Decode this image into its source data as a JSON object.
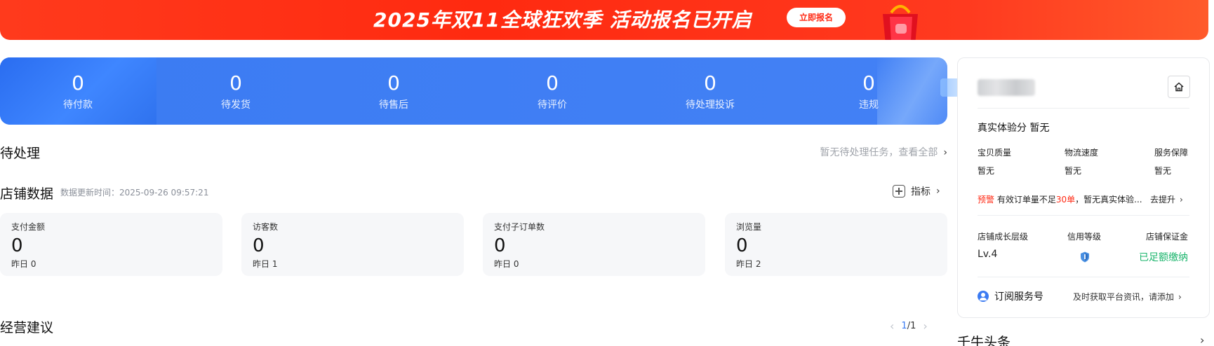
{
  "banner": {
    "title": "2025年双11全球狂欢季 活动报名已开启",
    "button_label": "立即报名"
  },
  "order_status": [
    {
      "value": "0",
      "label": "待付款"
    },
    {
      "value": "0",
      "label": "待发货"
    },
    {
      "value": "0",
      "label": "待售后"
    },
    {
      "value": "0",
      "label": "待评价"
    },
    {
      "value": "0",
      "label": "待处理投诉"
    },
    {
      "value": "0",
      "label": "违规"
    }
  ],
  "pending": {
    "title": "待处理",
    "link_text": "暂无待处理任务，查看全部"
  },
  "store_data": {
    "title": "店铺数据",
    "update_time": "数据更新时间：2025-09-26 09:57:21",
    "metrics_link": "指标",
    "cards": [
      {
        "label": "支付金额",
        "value": "0",
        "yesterday": "昨日 0"
      },
      {
        "label": "访客数",
        "value": "0",
        "yesterday": "昨日 1"
      },
      {
        "label": "支付子订单数",
        "value": "0",
        "yesterday": "昨日 0"
      },
      {
        "label": "浏览量",
        "value": "0",
        "yesterday": "昨日 2"
      }
    ]
  },
  "advice": {
    "title": "经营建议",
    "page_current": "1",
    "page_sep": "/",
    "page_total": "1"
  },
  "panel": {
    "experience_title": "真实体验分 暂无",
    "quality_label": "宝贝质量",
    "quality_value": "暂无",
    "logistics_label": "物流速度",
    "logistics_value": "暂无",
    "service_label": "服务保障",
    "service_value": "暂无",
    "warn_prefix": "预警",
    "warn_mid": " 有效订单量不足",
    "warn_red": "30单",
    "warn_suffix": "，暂无真实体验...",
    "improve_label": "去提升",
    "growth_label": "店铺成长层级",
    "growth_value": "Lv.4",
    "credit_label": "信用等级",
    "deposit_label": "店铺保证金",
    "deposit_value": "已足额缴纳",
    "subscribe_label": "订阅服务号",
    "subscribe_desc": "及时获取平台资讯，请添加"
  },
  "bottom": {
    "title": "千牛头条"
  },
  "colors": {
    "banner_red": "#ff2a10",
    "status_blue": "#3b7bf2",
    "warn_red": "#ff2a14",
    "paid_green": "#19b46b"
  }
}
